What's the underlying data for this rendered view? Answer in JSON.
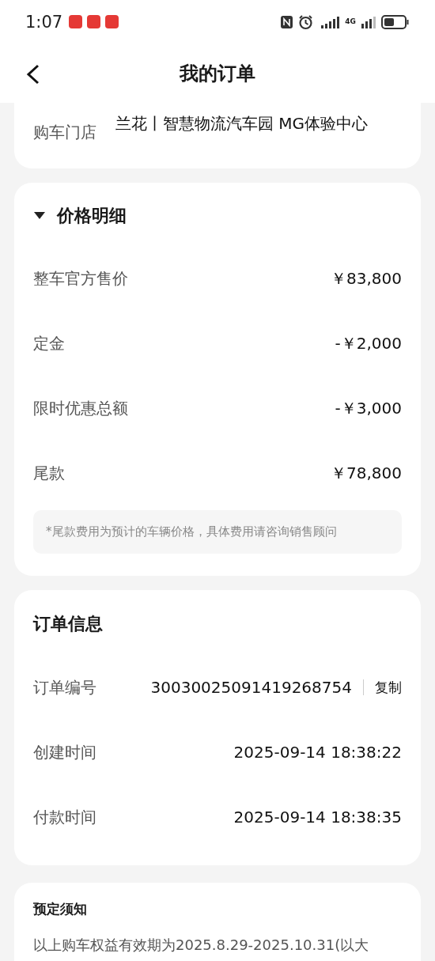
{
  "status_bar": {
    "time": "1:07",
    "network": "4G"
  },
  "header": {
    "title": "我的订单"
  },
  "store": {
    "label": "购车门店",
    "value": "兰花丨智慧物流汽车园 MG体验中心"
  },
  "price_detail": {
    "title": "价格明细",
    "expanded": true,
    "rows": [
      {
        "label": "整车官方售价",
        "value": "￥83,800"
      },
      {
        "label": "定金",
        "value": "-￥2,000"
      },
      {
        "label": "限时优惠总额",
        "value": "-￥3,000"
      },
      {
        "label": "尾款",
        "value": "￥78,800"
      }
    ],
    "note": "*尾款费用为预计的车辆价格，具体费用请咨询销售顾问"
  },
  "order_info": {
    "title": "订单信息",
    "rows": [
      {
        "label": "订单编号",
        "value": "30030025091419268754",
        "action": "复制"
      },
      {
        "label": "创建时间",
        "value": "2025-09-14 18:38:22"
      },
      {
        "label": "付款时间",
        "value": "2025-09-14 18:38:35"
      }
    ]
  },
  "notice": {
    "title": "预定须知",
    "text": "以上购车权益有效期为2025.8.29-2025.10.31(以大"
  }
}
